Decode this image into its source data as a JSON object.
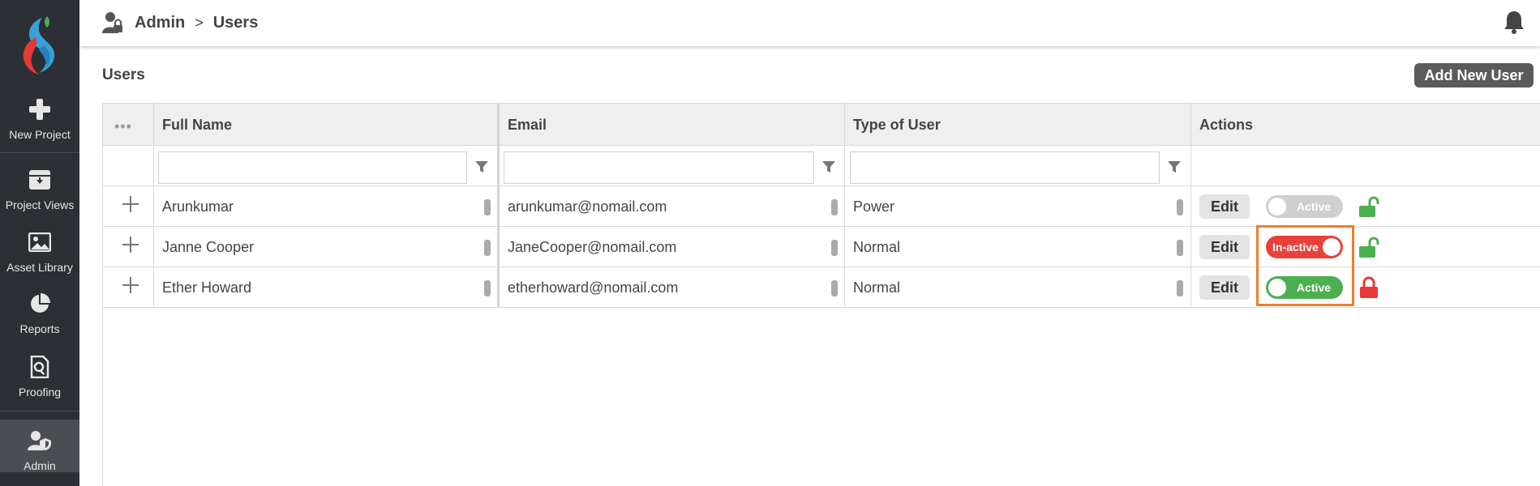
{
  "sidebar": {
    "items": [
      {
        "label": "New Project",
        "icon": "plus-icon"
      },
      {
        "label": "Project Views",
        "icon": "download-box-icon"
      },
      {
        "label": "Asset Library",
        "icon": "image-icon"
      },
      {
        "label": "Reports",
        "icon": "pie-chart-icon"
      },
      {
        "label": "Proofing",
        "icon": "document-search-icon"
      },
      {
        "label": "Admin",
        "icon": "user-shield-icon",
        "active": true
      }
    ]
  },
  "header": {
    "breadcrumb": {
      "root": "Admin",
      "separator": ">",
      "current": "Users"
    }
  },
  "page": {
    "title": "Users",
    "add_button": "Add New User"
  },
  "table": {
    "columns": [
      "Full Name",
      "Email",
      "Type of User",
      "Actions"
    ],
    "rows": [
      {
        "name": "Arunkumar",
        "email": "arunkumar@nomail.com",
        "type": "Power",
        "edit": "Edit",
        "status": "Active",
        "status_color": "grey",
        "lock": "unlocked"
      },
      {
        "name": "Janne Cooper",
        "email": "JaneCooper@nomail.com",
        "type": "Normal",
        "edit": "Edit",
        "status": "In-active",
        "status_color": "red",
        "lock": "unlocked"
      },
      {
        "name": "Ether Howard",
        "email": "etherhoward@nomail.com",
        "type": "Normal",
        "edit": "Edit",
        "status": "Active",
        "status_color": "green",
        "lock": "locked"
      }
    ]
  },
  "colors": {
    "sidebar_bg": "#2c2f33",
    "active_green": "#4caf50",
    "inactive_red": "#e8413a",
    "highlight_orange": "#f07d2a"
  }
}
